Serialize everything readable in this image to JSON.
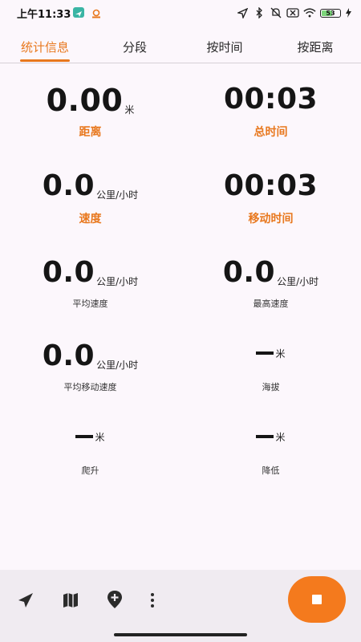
{
  "status": {
    "time": "上午11:33",
    "battery": "53"
  },
  "tabs": [
    "统计信息",
    "分段",
    "按时间",
    "按距离"
  ],
  "stats": {
    "distance": {
      "value": "0.00",
      "unit": "米",
      "label": "距离"
    },
    "total_time": {
      "value": "00:03",
      "label": "总时间"
    },
    "speed": {
      "value": "0.0",
      "unit": "公里/小时",
      "label": "速度"
    },
    "moving_time": {
      "value": "00:03",
      "label": "移动时间"
    },
    "avg_speed": {
      "value": "0.0",
      "unit": "公里/小时",
      "label": "平均速度"
    },
    "max_speed": {
      "value": "0.0",
      "unit": "公里/小时",
      "label": "最高速度"
    },
    "avg_moving_speed": {
      "value": "0.0",
      "unit": "公里/小时",
      "label": "平均移动速度"
    },
    "altitude": {
      "unit": "米",
      "label": "海拔"
    },
    "climb": {
      "unit": "米",
      "label": "爬升"
    },
    "descent": {
      "unit": "米",
      "label": "降低"
    }
  },
  "colors": {
    "accent": "#e8781e",
    "fab": "#f47a1d"
  },
  "bottom_icons": [
    "navigation-arrow-icon",
    "map-icon",
    "add-location-icon",
    "more-vert-icon",
    "stop-icon"
  ]
}
